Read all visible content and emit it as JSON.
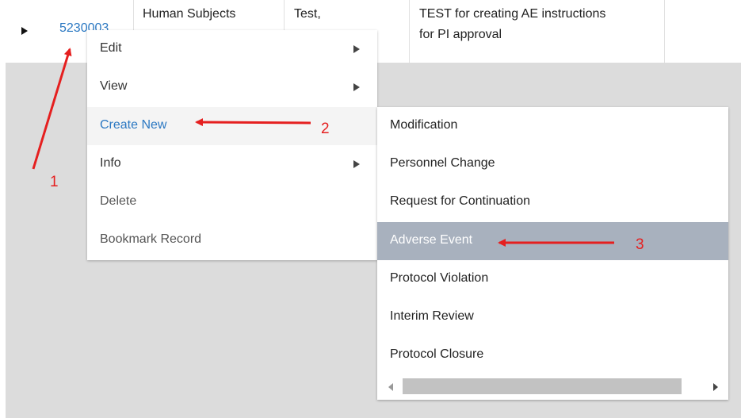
{
  "row": {
    "record_id": "5230003",
    "type": "Human Subjects",
    "pi": "Test,",
    "title_line1": "TEST for creating AE instructions",
    "title_line2": "for PI approval"
  },
  "context_menu": {
    "items": [
      {
        "label": "Edit",
        "has_submenu": true
      },
      {
        "label": "View",
        "has_submenu": true
      },
      {
        "label": "Create New",
        "has_submenu": false,
        "active": true
      },
      {
        "label": "Info",
        "has_submenu": true
      },
      {
        "label": "Delete",
        "has_submenu": false
      },
      {
        "label": "Bookmark Record",
        "has_submenu": false
      }
    ]
  },
  "submenu": {
    "items": [
      {
        "label": "Modification"
      },
      {
        "label": "Personnel Change"
      },
      {
        "label": "Request for Continuation"
      },
      {
        "label": "Adverse Event",
        "highlighted": true
      },
      {
        "label": "Protocol Violation"
      },
      {
        "label": "Interim Review"
      },
      {
        "label": "Protocol Closure"
      }
    ]
  },
  "annotations": {
    "label_1": "1",
    "label_2": "2",
    "label_3": "3",
    "color": "#e51f1f"
  },
  "colors": {
    "link": "#2b78c2",
    "highlight": "#a8b1be",
    "backdrop": "#dcdcdc"
  }
}
